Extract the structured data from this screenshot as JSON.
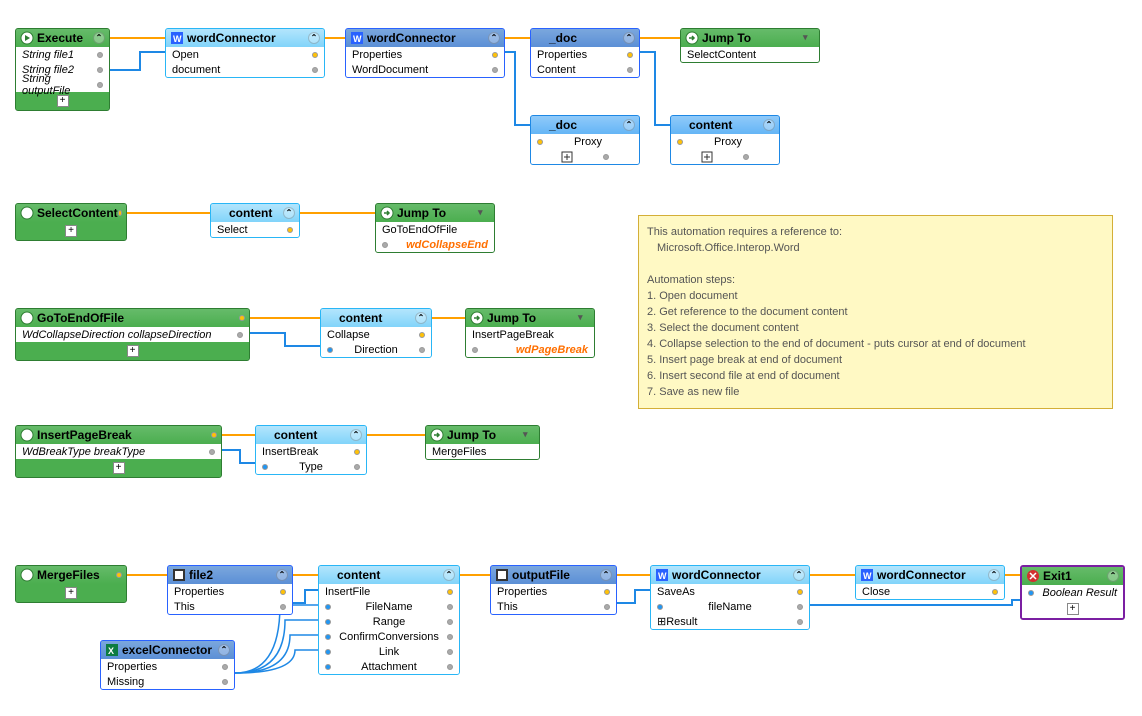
{
  "nodes": {
    "execute": {
      "title": "Execute",
      "params": [
        "String file1",
        "String file2",
        "String outputFile"
      ]
    },
    "wc1": {
      "title": "wordConnector",
      "rows": [
        "Open",
        "document"
      ]
    },
    "wc2": {
      "title": "wordConnector",
      "rows": [
        "Properties",
        "WordDocument"
      ]
    },
    "doc1": {
      "title": "_doc",
      "rows": [
        "Properties",
        "Content"
      ]
    },
    "jump1": {
      "title": "Jump To",
      "target": "SelectContent"
    },
    "docProxy": {
      "title": "_doc",
      "rows": [
        "Proxy"
      ]
    },
    "contentProxy": {
      "title": "content",
      "rows": [
        "Proxy"
      ]
    },
    "selectContent": {
      "title": "SelectContent"
    },
    "contentSelect": {
      "title": "content",
      "rows": [
        "Select"
      ]
    },
    "jump2": {
      "title": "Jump To",
      "target": "GoToEndOfFile",
      "param": "wdCollapseEnd"
    },
    "goToEnd": {
      "title": "GoToEndOfFile",
      "params": [
        "WdCollapseDirection collapseDirection"
      ]
    },
    "contentCollapse": {
      "title": "content",
      "rows": [
        "Collapse",
        "Direction"
      ]
    },
    "jump3": {
      "title": "Jump To",
      "target": "InsertPageBreak",
      "param": "wdPageBreak"
    },
    "insertPB": {
      "title": "InsertPageBreak",
      "params": [
        "WdBreakType breakType"
      ]
    },
    "contentIB": {
      "title": "content",
      "rows": [
        "InsertBreak",
        "Type"
      ]
    },
    "jump4": {
      "title": "Jump To",
      "target": "MergeFiles"
    },
    "mergeFiles": {
      "title": "MergeFiles"
    },
    "file2": {
      "title": "file2",
      "rows": [
        "Properties",
        "This"
      ]
    },
    "excelCon": {
      "title": "excelConnector",
      "rows": [
        "Properties",
        "Missing"
      ]
    },
    "contentInsFile": {
      "title": "content",
      "rows": [
        "InsertFile",
        "FileName",
        "Range",
        "ConfirmConversions",
        "Link",
        "Attachment"
      ]
    },
    "outputFile": {
      "title": "outputFile",
      "rows": [
        "Properties",
        "This"
      ]
    },
    "wcSaveAs": {
      "title": "wordConnector",
      "rows": [
        "SaveAs",
        "fileName",
        "⊞Result"
      ]
    },
    "wcClose": {
      "title": "wordConnector",
      "rows": [
        "Close"
      ]
    },
    "exit1": {
      "title": "Exit1",
      "params": [
        "Boolean Result"
      ]
    }
  },
  "note": {
    "line1": "This automation requires a reference to:",
    "line2": "Microsoft.Office.Interop.Word",
    "stepsHeader": "Automation steps:",
    "steps": [
      "1. Open document",
      "2. Get reference to the document content",
      "3. Select the document content",
      "4. Collapse selection to the end of document - puts cursor at end of document",
      "5. Insert page break at end of document",
      "6. Insert second file at end of document",
      "7. Save as new file"
    ]
  }
}
